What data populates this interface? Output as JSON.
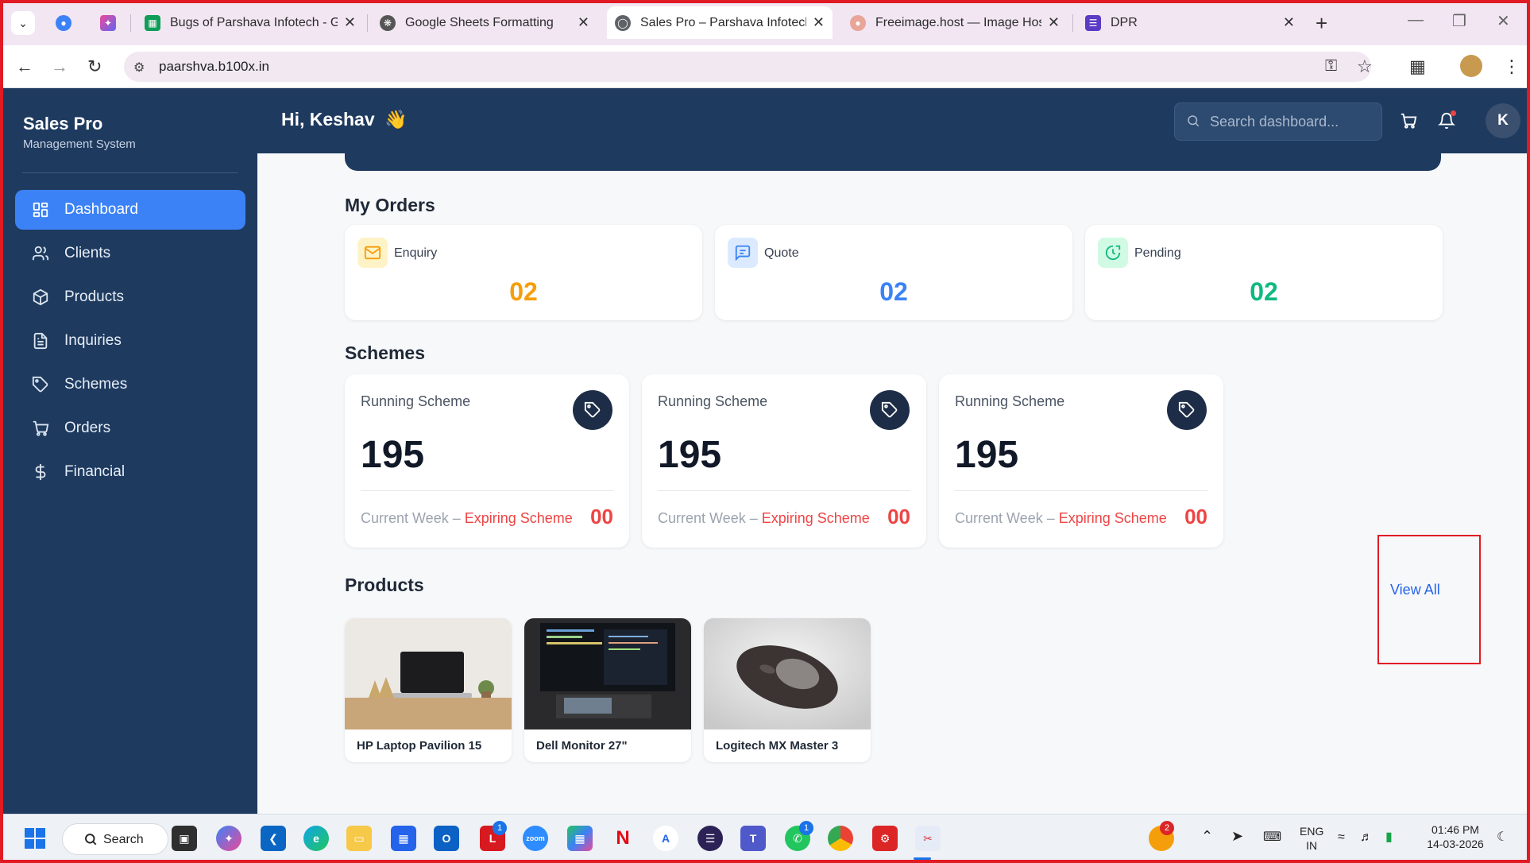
{
  "browser": {
    "tabs": [
      {
        "title": "Bugs of Parshava Infotech - Goo"
      },
      {
        "title": "Google Sheets Formatting"
      },
      {
        "title": "Sales Pro – Parshava Infotech"
      },
      {
        "title": "Freeimage.host — Image Hosting"
      },
      {
        "title": "DPR"
      }
    ],
    "url": "paarshva.b100x.in"
  },
  "app": {
    "brand": "Sales Pro",
    "brand_sub": "Management System",
    "greeting": "Hi, Keshav",
    "greeting_emoji": "👋",
    "search_placeholder": "Search dashboard...",
    "avatar_initial": "K"
  },
  "sidebar": {
    "items": [
      {
        "label": "Dashboard",
        "icon": "grid-icon"
      },
      {
        "label": "Clients",
        "icon": "users-icon"
      },
      {
        "label": "Products",
        "icon": "box-icon"
      },
      {
        "label": "Inquiries",
        "icon": "document-icon"
      },
      {
        "label": "Schemes",
        "icon": "tag-icon"
      },
      {
        "label": "Orders",
        "icon": "cart-icon"
      },
      {
        "label": "Financial",
        "icon": "dollar-icon"
      }
    ]
  },
  "orders": {
    "title": "My Orders",
    "cards": [
      {
        "label": "Enquiry",
        "value": "02",
        "color": "#f59e0b"
      },
      {
        "label": "Quote",
        "value": "02",
        "color": "#3b82f6"
      },
      {
        "label": "Pending",
        "value": "02",
        "color": "#10b981"
      }
    ]
  },
  "schemes": {
    "title": "Schemes",
    "cards": [
      {
        "label": "Running Scheme",
        "value": "195",
        "foot_prefix": "Current Week – ",
        "foot_exp": "Expiring Scheme",
        "count": "00"
      },
      {
        "label": "Running Scheme",
        "value": "195",
        "foot_prefix": "Current Week – ",
        "foot_exp": "Expiring Scheme",
        "count": "00"
      },
      {
        "label": "Running Scheme",
        "value": "195",
        "foot_prefix": "Current Week – ",
        "foot_exp": "Expiring Scheme",
        "count": "00"
      }
    ]
  },
  "products": {
    "title": "Products",
    "view_all": "View All",
    "items": [
      {
        "name": "HP Laptop Pavilion 15"
      },
      {
        "name": "Dell Monitor 27\""
      },
      {
        "name": "Logitech MX Master 3"
      }
    ]
  },
  "taskbar": {
    "search_label": "Search",
    "lang_1": "ENG",
    "lang_2": "IN",
    "time": "01:46 PM",
    "date": "14-03-2026",
    "badge_l": "1",
    "badge_whatsapp": "1",
    "badge_tray": "2"
  },
  "colors": {
    "sidebar_bg": "#1e3a5f",
    "accent": "#3b82f6",
    "expiring": "#ef4444"
  }
}
